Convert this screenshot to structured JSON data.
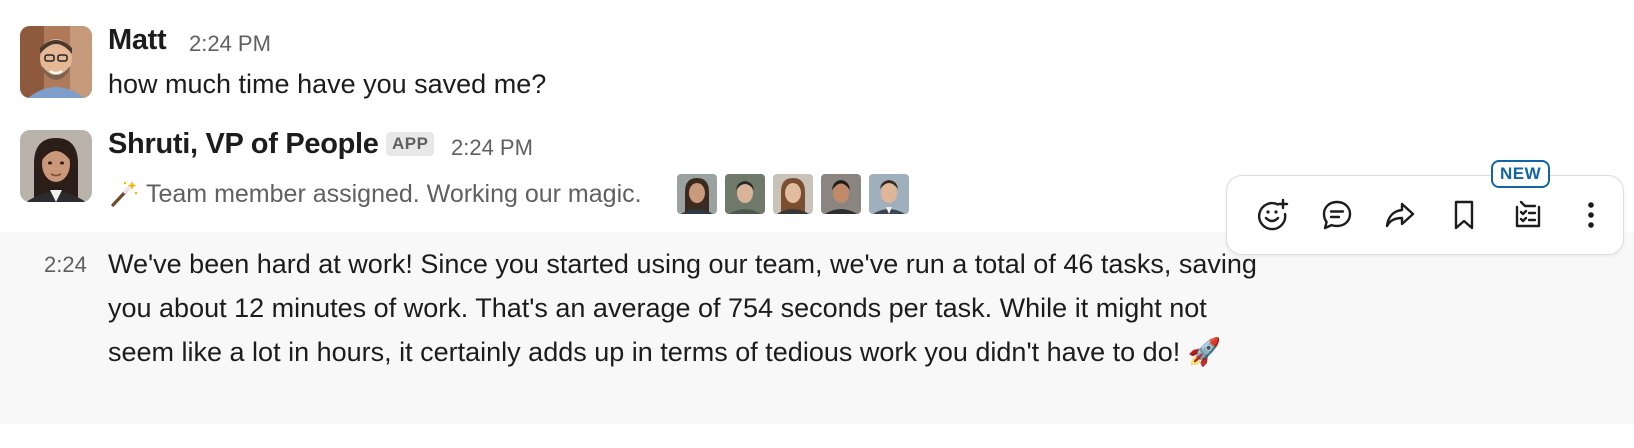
{
  "messages": [
    {
      "author": "Matt",
      "time": "2:24 PM",
      "text": "how much time have you saved me?"
    },
    {
      "author": "Shruti, VP of People",
      "badge": "APP",
      "time": "2:24 PM",
      "status_icon": "magic-wand-icon",
      "status": "Team member assigned. Working our magic."
    }
  ],
  "followup": {
    "time": "2:24",
    "text": "We've been hard at work! Since you started using our team, we've run a total of 46 tasks, saving you about 12 minutes of work. That's an average of 754 seconds per task. While it might not seem like a lot in hours, it certainly adds up in terms of tedious work you didn't have to do! 🚀"
  },
  "toolbar": {
    "new_badge": "NEW",
    "actions": [
      "add-reaction-icon",
      "reply-in-thread-icon",
      "forward-icon",
      "save-for-later-icon",
      "create-task-icon",
      "more-actions-icon"
    ]
  },
  "colors": {
    "text": "#1d1c1d",
    "muted": "#616061",
    "hover_bg": "#f8f8f8",
    "accent": "#1264a3"
  }
}
